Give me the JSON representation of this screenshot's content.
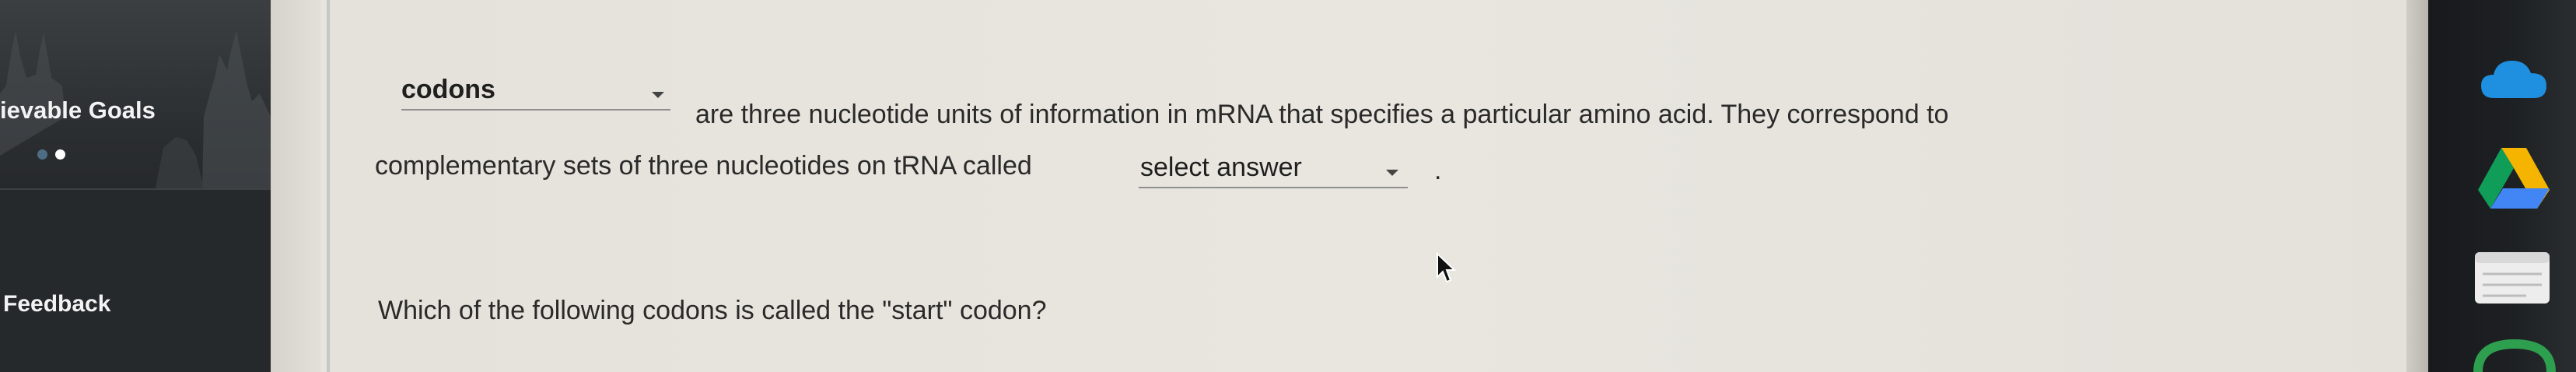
{
  "sidebar": {
    "title": "ievable Goals",
    "carousel_dots": 2,
    "active_dot": 1,
    "feedback_label": "Feedback"
  },
  "question1": {
    "select1": {
      "value": "codons"
    },
    "text_part1": "are three nucleotide units of information in mRNA that specifies a particular amino acid. They correspond to",
    "text_part2": "complementary sets of three nucleotides on tRNA called",
    "select2": {
      "value": "select answer"
    },
    "end_punctuation": "."
  },
  "question2": {
    "text": "Which of the following codons is called the \"start\" codon?"
  },
  "dock": {
    "icons": [
      "cloud-icon",
      "drive-icon",
      "notes-icon",
      "circle-app-icon"
    ]
  },
  "colors": {
    "sidebar_bg": "#26292c",
    "content_bg": "#e6e4dd",
    "dock_bg": "#1e2124",
    "dot_active": "#ffffff",
    "dot_inactive": "#4d6d86"
  }
}
